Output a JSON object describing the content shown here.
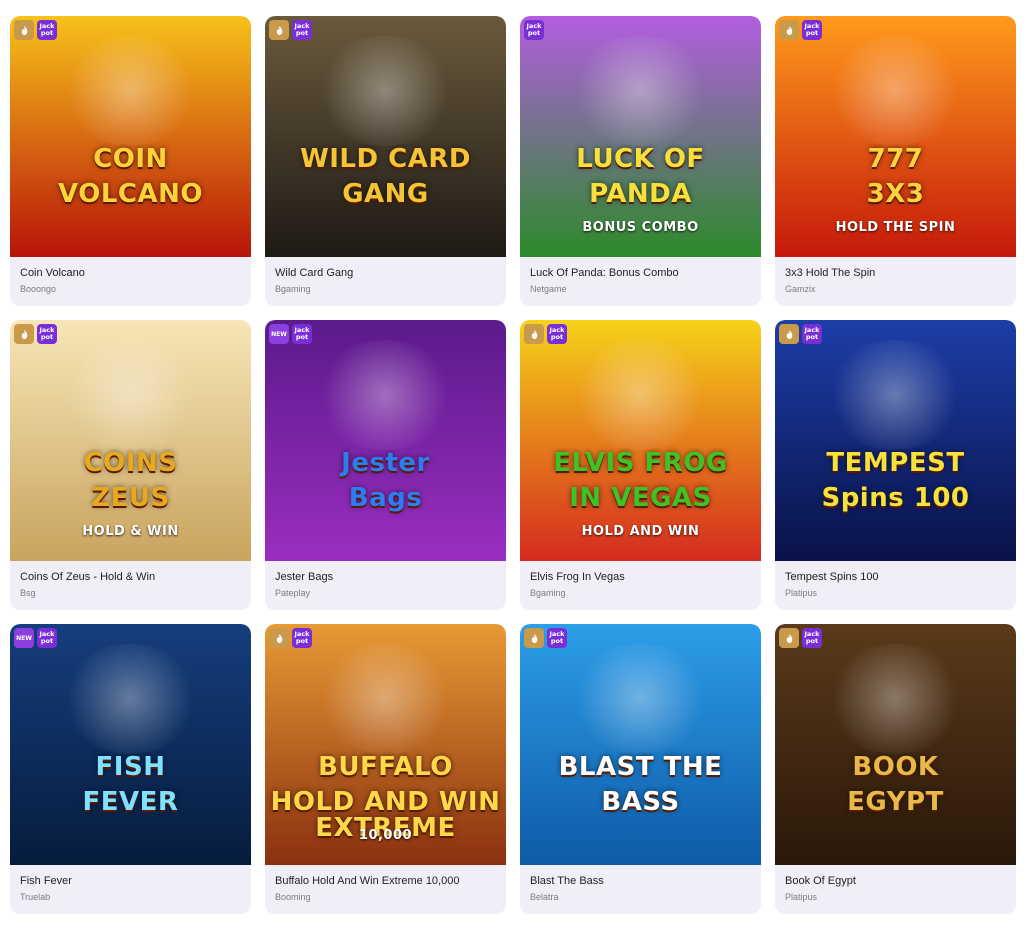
{
  "badges": {
    "jackpot_text": "Jack pot",
    "new_text": "NEW"
  },
  "games": [
    {
      "title": "Coin Volcano",
      "provider": "Booongo",
      "art_line1": "COIN",
      "art_line2": "VOLCANO",
      "badges": [
        "hot-icon",
        "jackpot"
      ],
      "bg_top": "#f7c21a",
      "bg_bottom": "#b8140a",
      "text_color": "#ffd23a"
    },
    {
      "title": "Wild Card Gang",
      "provider": "Bgaming",
      "art_line1": "WILD CARD",
      "art_line2": "GANG",
      "badges": [
        "hot-icon",
        "jackpot"
      ],
      "bg_top": "#6a5a3c",
      "bg_bottom": "#1e1a16",
      "text_color": "#f3c536"
    },
    {
      "title": "Luck Of Panda: Bonus Combo",
      "provider": "Netgame",
      "art_line1": "LUCK OF",
      "art_line2": "PANDA",
      "art_line3": "BONUS COMBO",
      "badges": [
        "jackpot"
      ],
      "bg_top": "#b35ee0",
      "bg_bottom": "#2c8a2a",
      "text_color": "#f6e13a"
    },
    {
      "title": "3x3 Hold The Spin",
      "provider": "Gamzix",
      "art_line1": "777",
      "art_line2": "3X3",
      "art_line3": "HOLD THE SPIN",
      "badges": [
        "hot-icon",
        "jackpot"
      ],
      "bg_top": "#ff9a1c",
      "bg_bottom": "#c5190b",
      "text_color": "#ffd23f"
    },
    {
      "title": "Coins Of Zeus - Hold & Win",
      "provider": "Bsg",
      "art_line1": "COINS",
      "art_line2": "ZEUS",
      "art_line3": "HOLD & WIN",
      "badges": [
        "hot-icon",
        "jackpot"
      ],
      "bg_top": "#f7e6b8",
      "bg_bottom": "#c9a45e",
      "text_color": "#e8a920"
    },
    {
      "title": "Jester Bags",
      "provider": "Pateplay",
      "art_line1": "Jester",
      "art_line2": "Bags",
      "badges": [
        "new",
        "jackpot"
      ],
      "bg_top": "#5b1a8a",
      "bg_bottom": "#9a2ec0",
      "text_color": "#2e7df0"
    },
    {
      "title": "Elvis Frog In Vegas",
      "provider": "Bgaming",
      "art_line1": "ELVIS FROG",
      "art_line2": "IN VEGAS",
      "art_line3": "HOLD AND WIN",
      "badges": [
        "hot-icon",
        "jackpot"
      ],
      "bg_top": "#f6d21a",
      "bg_bottom": "#d42a1f",
      "text_color": "#3fc226"
    },
    {
      "title": "Tempest Spins 100",
      "provider": "Platipus",
      "art_line1": "TEMPEST",
      "art_line2": "Spins 100",
      "badges": [
        "hot-icon",
        "jackpot"
      ],
      "bg_top": "#1c3ea8",
      "bg_bottom": "#0a1248",
      "text_color": "#f5e23c"
    },
    {
      "title": "Fish Fever",
      "provider": "Truelab",
      "art_line1": "FISH",
      "art_line2": "FEVER",
      "badges": [
        "new",
        "jackpot"
      ],
      "bg_top": "#153e7e",
      "bg_bottom": "#061c3c",
      "text_color": "#7fe0ff"
    },
    {
      "title": "Buffalo Hold And Win Extreme 10,000",
      "provider": "Booming",
      "art_line1": "BUFFALO",
      "art_line2": "HOLD AND WIN EXTREME",
      "art_line3": "10,000",
      "badges": [
        "hot-icon",
        "jackpot"
      ],
      "bg_top": "#e89a34",
      "bg_bottom": "#8a3010",
      "text_color": "#ffd84a"
    },
    {
      "title": "Blast The Bass",
      "provider": "Belatra",
      "art_line1": "BLAST THE",
      "art_line2": "BASS",
      "badges": [
        "hot-icon",
        "jackpot"
      ],
      "bg_top": "#2d9ee8",
      "bg_bottom": "#0e5aa8",
      "text_color": "#ffffff"
    },
    {
      "title": "Book Of Egypt",
      "provider": "Platipus",
      "art_line1": "BOOK",
      "art_line2": "EGYPT",
      "badges": [
        "hot-icon",
        "jackpot"
      ],
      "bg_top": "#5a3a1a",
      "bg_bottom": "#2a180a",
      "text_color": "#e8b84a"
    }
  ]
}
